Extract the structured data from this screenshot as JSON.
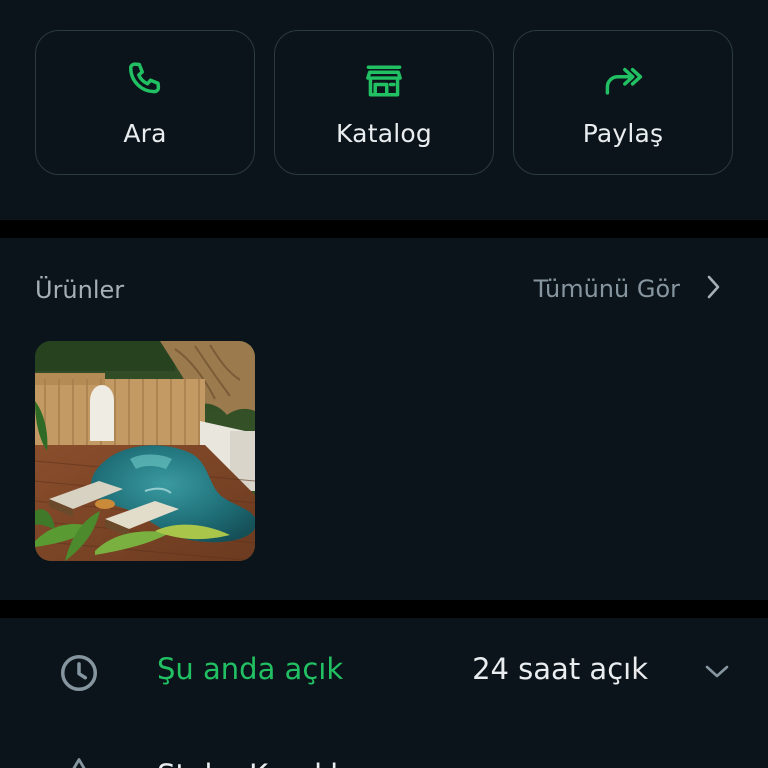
{
  "colors": {
    "background": "#0b141a",
    "divider": "#000000",
    "accent_green": "#21c063",
    "card_border": "#2a3942",
    "text_primary": "#e9edef",
    "text_secondary": "#8696a0"
  },
  "actions": [
    {
      "label": "Ara",
      "icon": "phone-icon"
    },
    {
      "label": "Katalog",
      "icon": "storefront-icon"
    },
    {
      "label": "Paylaş",
      "icon": "forward-share-icon"
    }
  ],
  "products": {
    "title": "Ürünler",
    "see_all": "Tümünü Gör",
    "items": [
      {
        "image": "pool-terrace-photo"
      }
    ]
  },
  "hours": {
    "status": "Şu anda açık",
    "schedule": "24 saat açık"
  },
  "next_row": {
    "text": "Stok · Kandıl"
  }
}
